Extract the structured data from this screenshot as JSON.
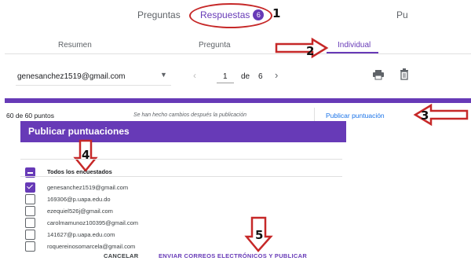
{
  "top_tabs": {
    "questions": "Preguntas",
    "responses": "Respuestas",
    "responses_count": "6",
    "truncated": "Pu"
  },
  "sub_tabs": {
    "summary": "Resumen",
    "question": "Pregunta",
    "individual": "Individual"
  },
  "responder_bar": {
    "selected_email": "genesanchez1519@gmail.com",
    "page_current": "1",
    "page_of": "de",
    "page_total": "6"
  },
  "score_bar": {
    "points": "60 de 60 puntos",
    "notice": "Se han hecho cambios después la publicación",
    "publish_button": "Publicar puntuación"
  },
  "dialog": {
    "title": "Publicar puntuaciones",
    "select_all": "Todos los encuestados",
    "respondents": [
      {
        "email": "genesanchez1519@gmail.com",
        "checked": true
      },
      {
        "email": "169306@p.uapa.edu.do",
        "checked": false
      },
      {
        "email": "ezequiel526j@gmail.com",
        "checked": false
      },
      {
        "email": "carolmamunoz100395@gmail.com",
        "checked": false
      },
      {
        "email": "141627@p.uapa.edu.com",
        "checked": false
      },
      {
        "email": "roquereinosomarcela@gmail.com",
        "checked": false
      }
    ],
    "cancel": "CANCELAR",
    "send": "ENVIAR CORREOS ELECTRÓNICOS Y PUBLICAR"
  },
  "annotations": {
    "n1": "1",
    "n2": "2",
    "n3": "3",
    "n4": "4",
    "n5": "5"
  },
  "colors": {
    "accent": "#673ab7",
    "annotation": "#c62828"
  }
}
